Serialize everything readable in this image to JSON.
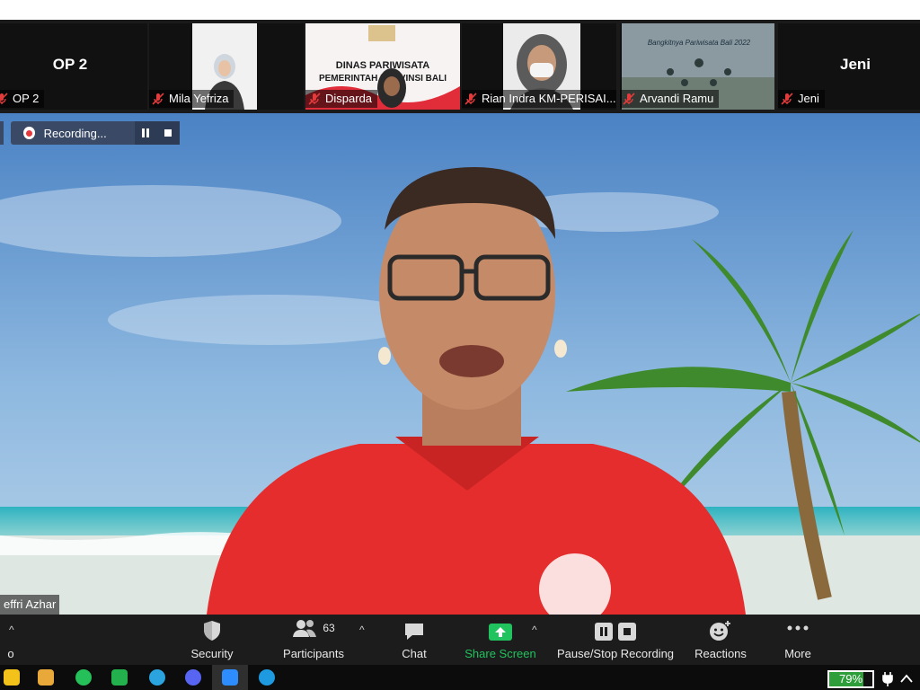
{
  "gallery": {
    "tiles": [
      {
        "name": "OP 2",
        "label": "OP 2"
      },
      {
        "name": "",
        "label": "Mila Yefriza"
      },
      {
        "name": "",
        "label": "Disparda",
        "slide_line1": "DINAS PARIWISATA",
        "slide_line2": "PEMERINTAH PROVINSI BALI"
      },
      {
        "name": "",
        "label": "Rian Indra KM-PERISAI..."
      },
      {
        "name": "",
        "label": "Arvandi Ramu",
        "slide_title": "Bangkitnya Pariwisata Bali 2022"
      },
      {
        "name": "Jeni",
        "label": "Jeni"
      }
    ]
  },
  "recording": {
    "label": "Recording..."
  },
  "speaker": {
    "label": "effri Azhar"
  },
  "toolbar": {
    "left_label": "o",
    "security": "Security",
    "participants": "Participants",
    "participants_count": "63",
    "chat": "Chat",
    "share_screen": "Share Screen",
    "pause_stop_recording": "Pause/Stop Recording",
    "reactions": "Reactions",
    "more": "More"
  },
  "taskbar": {
    "battery_text": "79%",
    "battery_level": 0.79
  },
  "colors": {
    "share_green": "#20c35d",
    "mic_off_red": "#e23b3b",
    "recording_bar": "#3a4a66",
    "shirt_red": "#e52d2d"
  },
  "icons": [
    "mic-off-icon",
    "record-icon",
    "pause-icon",
    "stop-icon",
    "shield-icon",
    "participants-icon",
    "chat-icon",
    "share-screen-icon",
    "reactions-icon",
    "more-icon",
    "battery-icon",
    "plug-icon"
  ]
}
